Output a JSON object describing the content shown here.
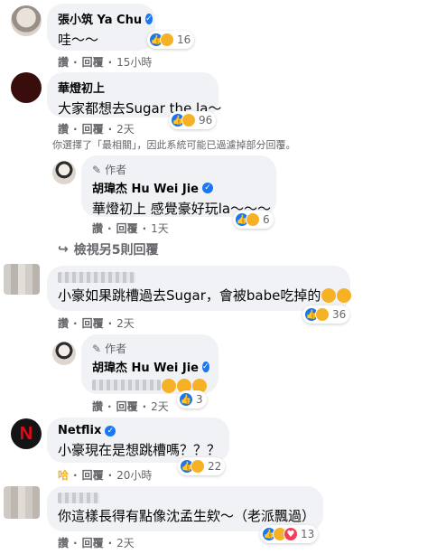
{
  "colors": {
    "like": "#1877f2",
    "haha": "#f7b125",
    "love": "#f33e58",
    "bubble": "#f0f2f5",
    "meta": "#65676b"
  },
  "actions": {
    "like": "讚",
    "reply": "回覆"
  },
  "author_badge": "作者",
  "comments": [
    {
      "name": "張小筑 Ya Chu",
      "text": "哇～～",
      "reactions_count": "16",
      "time": "15小時"
    },
    {
      "name": "華燈初上",
      "text": "大家都想去Sugar the la～",
      "reactions_count": "96",
      "time": "2天"
    },
    {
      "name": "胡瑋杰 Hu Wei Jie",
      "text": "華燈初上 感覺豪好玩la～～～",
      "reactions_count": "6",
      "time": "1天"
    },
    {
      "name": "",
      "text": "小豪如果跳槽過去Sugar，會被babe吃掉的",
      "reactions_count": "36",
      "time": "2天"
    },
    {
      "name": "胡瑋杰 Hu Wei Jie",
      "text": "",
      "reactions_count": "3",
      "time": "2天"
    },
    {
      "name": "Netflix",
      "text": "小豪現在是想跳槽嗎？？？",
      "reactions_count": "22",
      "time": "20小時",
      "like_label": "哈"
    },
    {
      "name": "",
      "text": "你這樣長得有點像沈孟生欸～（老派飄過）",
      "reactions_count": "13",
      "time": "2天"
    }
  ],
  "filter_note": "你選擇了「最相關」，因此系統可能已過濾掉部分回覆。",
  "view_more": "檢視另5則回覆"
}
